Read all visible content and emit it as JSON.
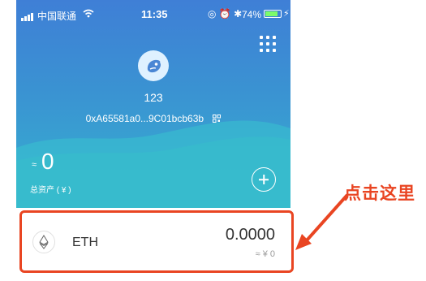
{
  "status_bar": {
    "carrier": "中国联通",
    "time": "11:35",
    "battery": "74%",
    "icons": [
      "signal-icon",
      "wifi-icon",
      "location-icon",
      "alarm-icon",
      "bluetooth-icon",
      "battery-icon",
      "charging-icon"
    ]
  },
  "wallet": {
    "name": "123",
    "address": "0xA65581a0...9C01bcb63b",
    "balance_prefix": "≈",
    "balance": "0",
    "balance_label": "总资产 ( ¥ )",
    "menu_icon": "grid-icon",
    "avatar_icon": "avatar-icon",
    "add_icon": "add-icon",
    "qr_icon": "qr-code-icon",
    "colors": {
      "gradient_top": "#3f7fd6",
      "gradient_bottom": "#36b2cf"
    }
  },
  "tokens": [
    {
      "symbol": "ETH",
      "balance": "0.0000",
      "value": "≈ ¥ 0",
      "icon": "eth-icon"
    }
  ],
  "annotation": {
    "text": "点击这里",
    "color": "#e94522"
  }
}
